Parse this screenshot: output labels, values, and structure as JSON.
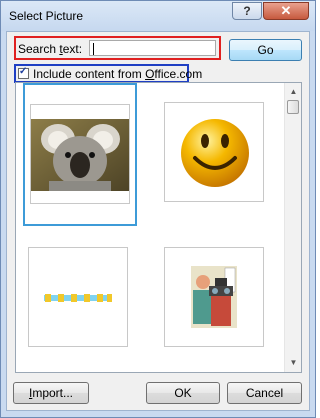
{
  "window": {
    "title": "Select Picture",
    "help_glyph": "?",
    "close_glyph": "✕"
  },
  "search": {
    "label_prefix": "Search ",
    "label_access_key": "t",
    "label_suffix": "ext:",
    "value": "",
    "go_label": "Go"
  },
  "include_office": {
    "checked": true,
    "label_prefix": "Include content from ",
    "label_access_key": "O",
    "label_suffix": "ffice.com"
  },
  "results": {
    "items": [
      {
        "name": "koala",
        "selected": true
      },
      {
        "name": "smiley-face",
        "selected": false
      },
      {
        "name": "dotted-border",
        "selected": false
      },
      {
        "name": "eye-exam",
        "selected": false
      }
    ],
    "scroll": {
      "up_glyph": "▲",
      "down_glyph": "▼"
    }
  },
  "buttons": {
    "import_label": "Import...",
    "import_access_key": "I",
    "import_rest": "mport...",
    "ok_label": "OK",
    "cancel_label": "Cancel"
  },
  "colors": {
    "search_highlight": "#e02020",
    "checkbox_highlight": "#1f3fc4",
    "selection_border": "#3d9bd8"
  }
}
